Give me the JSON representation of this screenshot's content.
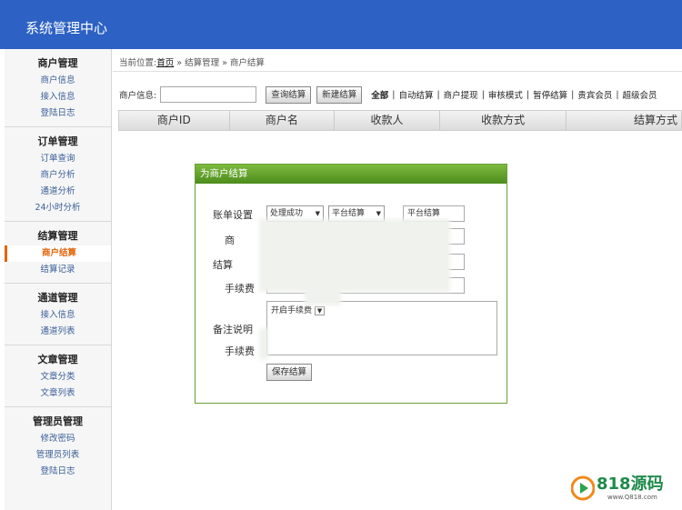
{
  "header": {
    "title": "系统管理中心"
  },
  "sidebar": {
    "groups": [
      {
        "title": "商户管理",
        "items": [
          "商户信息",
          "接入信息",
          "登陆日志"
        ]
      },
      {
        "title": "订单管理",
        "items": [
          "订单查询",
          "商户分析",
          "通道分析",
          "24小时分析"
        ]
      },
      {
        "title": "结算管理",
        "items": [
          "商户结算",
          "结算记录"
        ]
      },
      {
        "title": "通道管理",
        "items": [
          "接入信息",
          "通道列表"
        ]
      },
      {
        "title": "文章管理",
        "items": [
          "文章分类",
          "文章列表"
        ]
      },
      {
        "title": "管理员管理",
        "items": [
          "修改密码",
          "管理员列表",
          "登陆日志"
        ]
      }
    ],
    "active_item": "商户结算"
  },
  "breadcrumb": {
    "prefix": "当前位置:",
    "home": "首页",
    "rest": " » 结算管理 » 商户结算"
  },
  "search": {
    "label": "商户信息:",
    "value": "",
    "query_button": "查询结算",
    "new_button": "新建结算",
    "filters": [
      "全部",
      "自动结算",
      "商户提现",
      "审核模式",
      "暂停结算",
      "贵宾会员",
      "超级会员"
    ]
  },
  "table": {
    "columns": [
      "商户ID",
      "商户名",
      "收款人",
      "收款方式",
      "结算方式"
    ]
  },
  "modal": {
    "title": "为商户结算",
    "labels": {
      "account": "账单设置",
      "shop": "商",
      "settle": "结算",
      "fee": "手续费",
      "remark": "备注说明",
      "fee2": "手续费"
    },
    "select_status": "处理成功",
    "select_platform": "平台结算",
    "field_platform": "平台结算",
    "open_fee": "开启手续费",
    "save_button": "保存结算"
  },
  "watermark": {
    "brand": "818源码",
    "url": "www.Q818.com"
  }
}
